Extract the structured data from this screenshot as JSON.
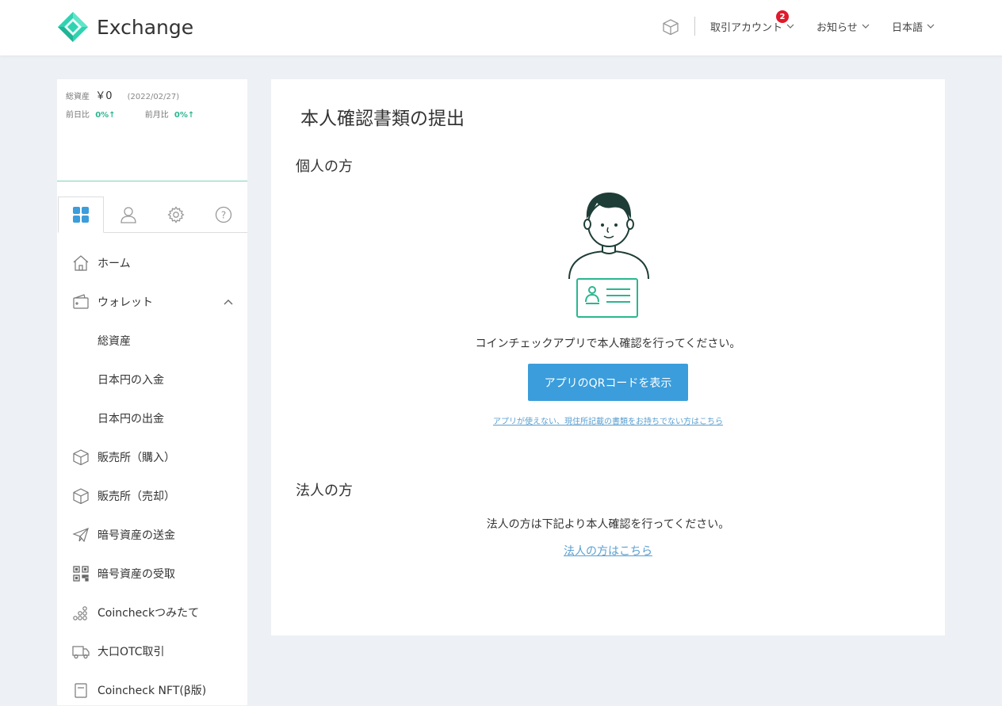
{
  "header": {
    "logo_text": "Exchange",
    "badge_count": "2",
    "menu": {
      "trading_account": "取引アカウント",
      "notices": "お知らせ",
      "language": "日本語"
    }
  },
  "sidebar": {
    "assets": {
      "label": "総資産",
      "amount": "￥0",
      "date": "(2022/02/27)",
      "day_label": "前日比",
      "day_value": "0%↑",
      "month_label": "前月比",
      "month_value": "0%↑"
    },
    "nav": [
      {
        "label": "ホーム"
      },
      {
        "label": "ウォレット"
      },
      {
        "label": "総資産"
      },
      {
        "label": "日本円の入金"
      },
      {
        "label": "日本円の出金"
      },
      {
        "label": "販売所（購入）"
      },
      {
        "label": "販売所（売却）"
      },
      {
        "label": "暗号資産の送金"
      },
      {
        "label": "暗号資産の受取"
      },
      {
        "label": "Coincheckつみたて"
      },
      {
        "label": "大口OTC取引"
      },
      {
        "label": "Coincheck NFT(β版)"
      }
    ]
  },
  "main": {
    "title": "本人確認書類の提出",
    "individual_heading": "個人の方",
    "individual_text": "コインチェックアプリで本人確認を行ってください。",
    "qr_button": "アプリのQRコードを表示",
    "no_app_link": "アプリが使えない、現住所記載の書類をお持ちでない方はこちら",
    "corporate_heading": "法人の方",
    "corporate_text": "法人の方は下記より本人確認を行ってください。",
    "corporate_link": "法人の方はこちら"
  },
  "colors": {
    "accent_green": "#2bb68f",
    "button_blue": "#3b9ddb",
    "link_blue": "#5a9fd0",
    "badge_red": "#e0192b",
    "background": "#edf0f4"
  }
}
